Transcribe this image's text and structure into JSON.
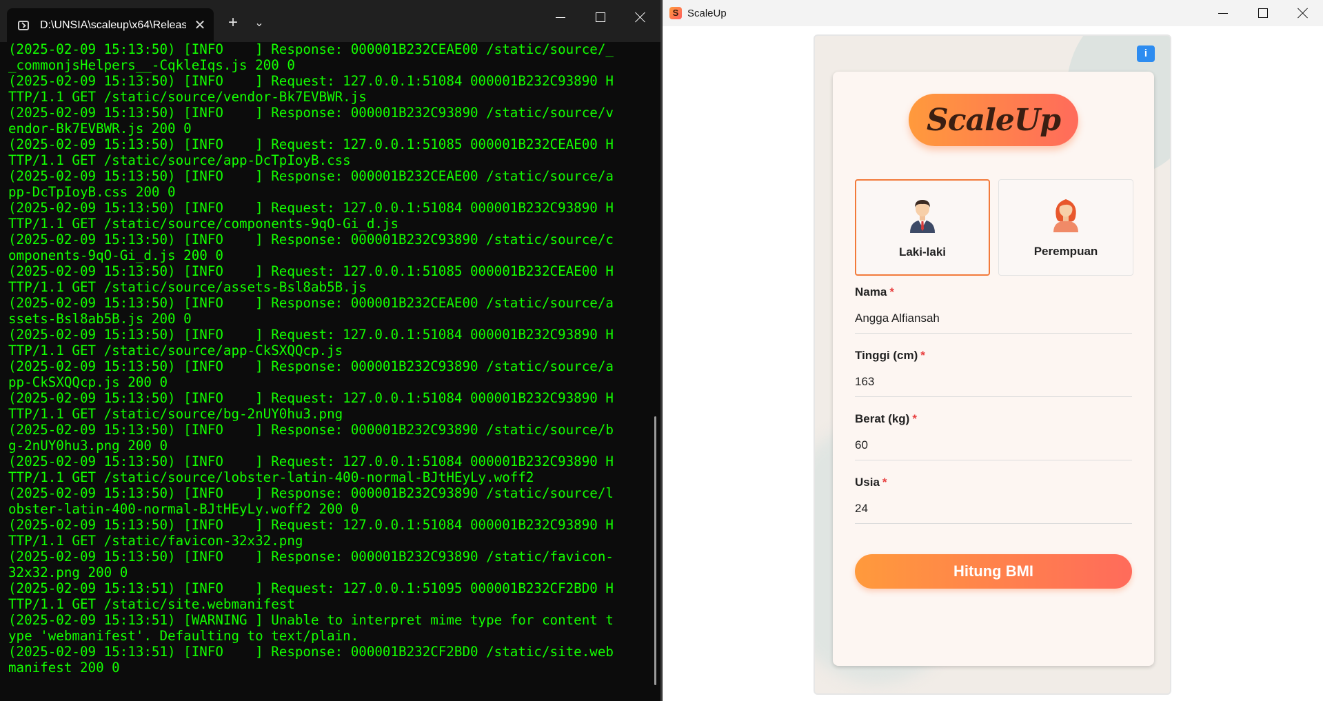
{
  "terminal": {
    "tab_title": "D:\\UNSIA\\scaleup\\x64\\Releas",
    "tab_close": "✕",
    "new_tab": "+",
    "dropdown": "⌄",
    "lines": [
      "(2025-02-09 15:13:50) [INFO    ] Response: 000001B232CEAE00 /static/source/_",
      "_commonjsHelpers__-CqkleIqs.js 200 0",
      "(2025-02-09 15:13:50) [INFO    ] Request: 127.0.0.1:51084 000001B232C93890 H",
      "TTP/1.1 GET /static/source/vendor-Bk7EVBWR.js",
      "(2025-02-09 15:13:50) [INFO    ] Response: 000001B232C93890 /static/source/v",
      "endor-Bk7EVBWR.js 200 0",
      "(2025-02-09 15:13:50) [INFO    ] Request: 127.0.0.1:51085 000001B232CEAE00 H",
      "TTP/1.1 GET /static/source/app-DcTpIoyB.css",
      "(2025-02-09 15:13:50) [INFO    ] Response: 000001B232CEAE00 /static/source/a",
      "pp-DcTpIoyB.css 200 0",
      "(2025-02-09 15:13:50) [INFO    ] Request: 127.0.0.1:51084 000001B232C93890 H",
      "TTP/1.1 GET /static/source/components-9qO-Gi_d.js",
      "(2025-02-09 15:13:50) [INFO    ] Response: 000001B232C93890 /static/source/c",
      "omponents-9qO-Gi_d.js 200 0",
      "(2025-02-09 15:13:50) [INFO    ] Request: 127.0.0.1:51085 000001B232CEAE00 H",
      "TTP/1.1 GET /static/source/assets-Bsl8ab5B.js",
      "(2025-02-09 15:13:50) [INFO    ] Response: 000001B232CEAE00 /static/source/a",
      "ssets-Bsl8ab5B.js 200 0",
      "(2025-02-09 15:13:50) [INFO    ] Request: 127.0.0.1:51084 000001B232C93890 H",
      "TTP/1.1 GET /static/source/app-CkSXQQcp.js",
      "(2025-02-09 15:13:50) [INFO    ] Response: 000001B232C93890 /static/source/a",
      "pp-CkSXQQcp.js 200 0",
      "(2025-02-09 15:13:50) [INFO    ] Request: 127.0.0.1:51084 000001B232C93890 H",
      "TTP/1.1 GET /static/source/bg-2nUY0hu3.png",
      "(2025-02-09 15:13:50) [INFO    ] Response: 000001B232C93890 /static/source/b",
      "g-2nUY0hu3.png 200 0",
      "(2025-02-09 15:13:50) [INFO    ] Request: 127.0.0.1:51084 000001B232C93890 H",
      "TTP/1.1 GET /static/source/lobster-latin-400-normal-BJtHEyLy.woff2",
      "(2025-02-09 15:13:50) [INFO    ] Response: 000001B232C93890 /static/source/l",
      "obster-latin-400-normal-BJtHEyLy.woff2 200 0",
      "(2025-02-09 15:13:50) [INFO    ] Request: 127.0.0.1:51084 000001B232C93890 H",
      "TTP/1.1 GET /static/favicon-32x32.png",
      "(2025-02-09 15:13:50) [INFO    ] Response: 000001B232C93890 /static/favicon-",
      "32x32.png 200 0",
      "(2025-02-09 15:13:51) [INFO    ] Request: 127.0.0.1:51095 000001B232CF2BD0 H",
      "TTP/1.1 GET /static/site.webmanifest",
      "(2025-02-09 15:13:51) [WARNING ] Unable to interpret mime type for content t",
      "ype 'webmanifest'. Defaulting to text/plain.",
      "(2025-02-09 15:13:51) [INFO    ] Response: 000001B232CF2BD0 /static/site.web",
      "manifest 200 0"
    ],
    "text_color": "#13ff00"
  },
  "app": {
    "window_title": "ScaleUp",
    "icon_letter": "S",
    "logo_text": "ScaleUp",
    "info_label": "i",
    "gender": {
      "male_label": "Laki-laki",
      "female_label": "Perempuan",
      "selected": "Laki-laki"
    },
    "fields": {
      "nama_label": "Nama",
      "nama_value": "Angga Alfiansah",
      "tinggi_label": "Tinggi (cm)",
      "tinggi_value": "163",
      "berat_label": "Berat (kg)",
      "berat_value": "60",
      "usia_label": "Usia",
      "usia_value": "24",
      "required_mark": "*"
    },
    "submit_label": "Hitung BMI",
    "accent_color": "#ff8a3d"
  }
}
